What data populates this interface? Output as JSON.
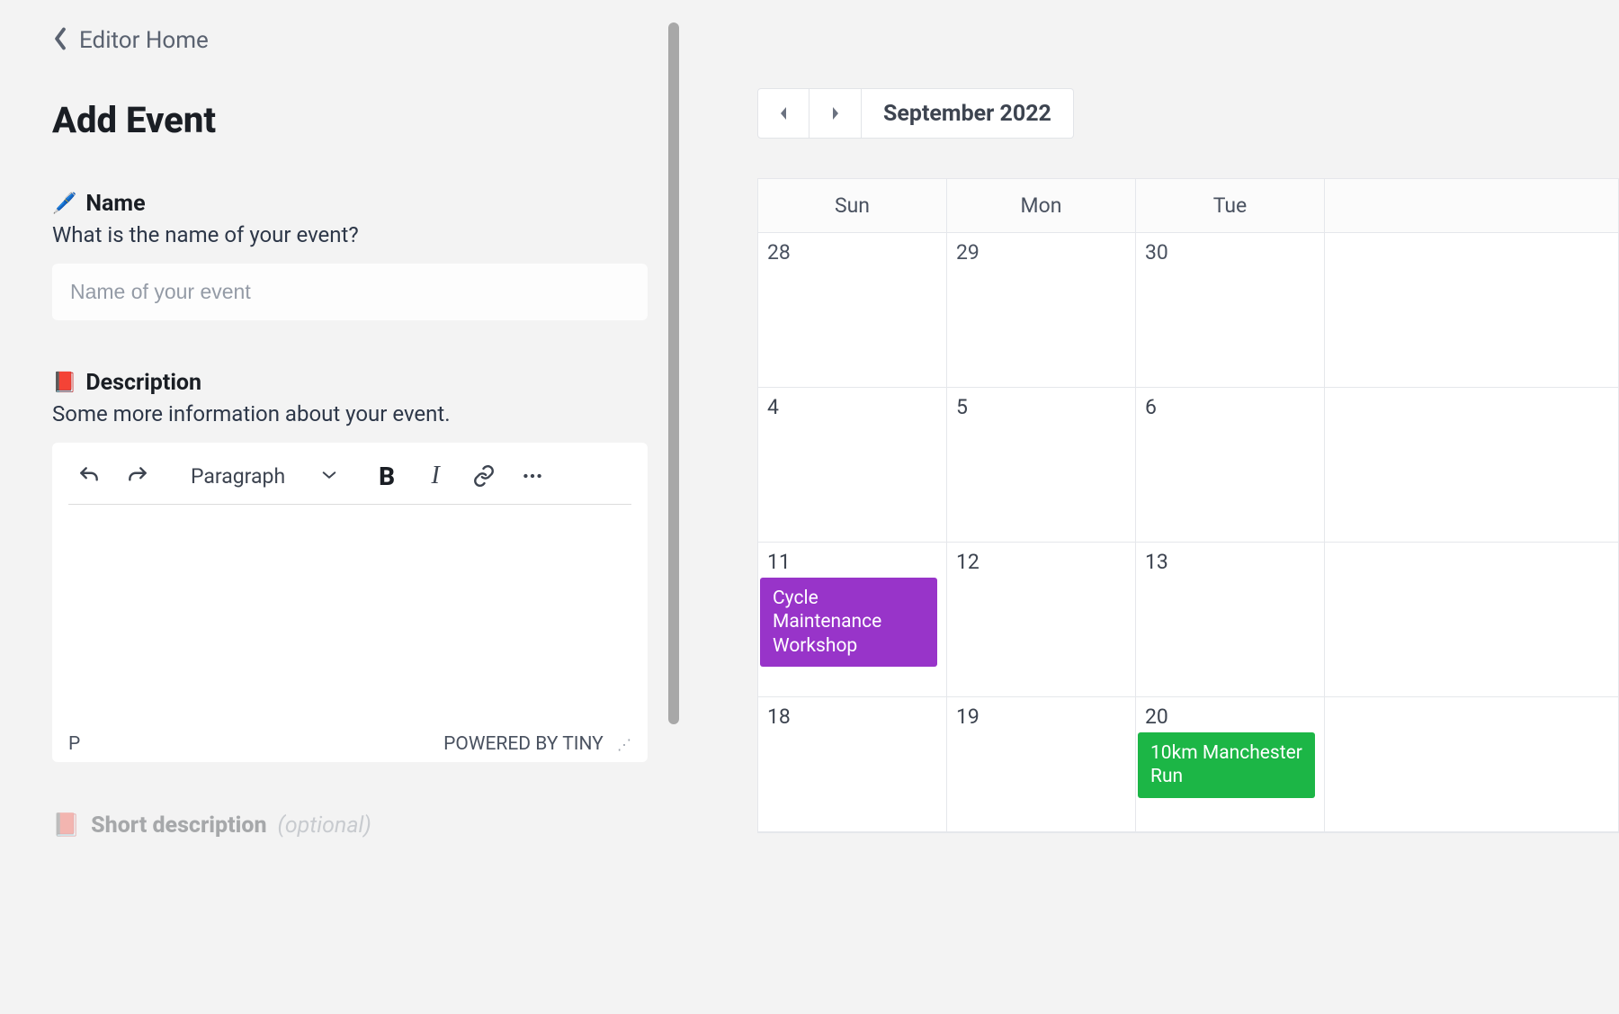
{
  "breadcrumb": {
    "label": "Editor Home"
  },
  "page_title": "Add Event",
  "name_field": {
    "icon": "🖊️",
    "label": "Name",
    "help": "What is the name of your event?",
    "placeholder": "Name of your event",
    "value": ""
  },
  "description_field": {
    "icon": "📕",
    "label": "Description",
    "help": "Some more information about your event."
  },
  "editor": {
    "paragraph_label": "Paragraph",
    "path": "P",
    "powered_by": "POWERED BY TINY"
  },
  "short_description": {
    "icon": "📕",
    "label": "Short description",
    "optional": "(optional)"
  },
  "calendar": {
    "title": "September 2022",
    "days": [
      "Sun",
      "Mon",
      "Tue"
    ],
    "rows": [
      [
        {
          "date": "28",
          "other": true
        },
        {
          "date": "29",
          "other": true
        },
        {
          "date": "30",
          "other": true
        }
      ],
      [
        {
          "date": "4"
        },
        {
          "date": "5"
        },
        {
          "date": "6"
        }
      ],
      [
        {
          "date": "11",
          "event": {
            "title": "Cycle Maintenance Workshop",
            "color": "purple"
          }
        },
        {
          "date": "12"
        },
        {
          "date": "13"
        }
      ],
      [
        {
          "date": "18"
        },
        {
          "date": "19"
        },
        {
          "date": "20",
          "event": {
            "title": "10km Manchester Run",
            "color": "green"
          }
        }
      ]
    ]
  }
}
